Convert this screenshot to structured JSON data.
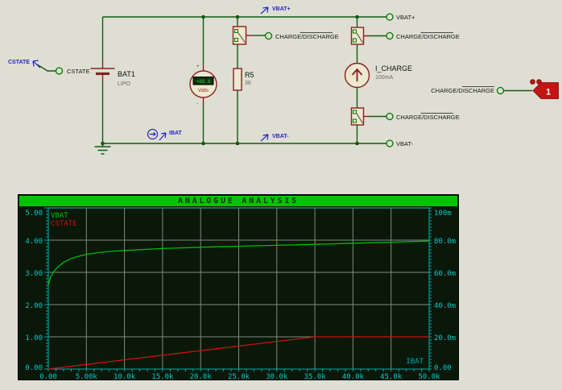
{
  "schematic": {
    "labels": {
      "cstate_wire": "CSTATE",
      "cstate_terminal": "CSTATE",
      "vbat_plus_wire": "VBAT+",
      "vbat_minus_wire": "VBAT-",
      "ibat_wire": "IBAT",
      "vbat_plus_terminal": "VBAT+",
      "vbat_minus_terminal": "VBAT-",
      "charge_discharge": "CHARGE/DISCHARGE"
    },
    "battery": {
      "ref": "BAT1",
      "value": "LIPO"
    },
    "resistor": {
      "ref": "R5",
      "value": "36"
    },
    "current_source": {
      "ref": "I_CHARGE",
      "value": "100mA"
    },
    "voltmeter": {
      "reading": "+88.8",
      "unit_label": "Volts",
      "plus": "+",
      "minus": "-"
    },
    "logic_probe": {
      "state": "1"
    },
    "colors": {
      "wire": "#145A14",
      "component": "#8C1E1E",
      "wire_label_blue": "#2828BE",
      "probe_red": "#C41414",
      "terminal_green": "#007A00"
    }
  },
  "chart_data": {
    "type": "line",
    "title": "ANALOGUE ANALYSIS",
    "grid": true,
    "legend_position": "top-left (left axis), bottom-right (right axis)",
    "x_axis": {
      "max": 50000,
      "ticks": [
        {
          "v": 0,
          "label": "0.00"
        },
        {
          "v": 5000,
          "label": "5.00k"
        },
        {
          "v": 10000,
          "label": "10.0k"
        },
        {
          "v": 15000,
          "label": "15.0k"
        },
        {
          "v": 20000,
          "label": "20.0k"
        },
        {
          "v": 25000,
          "label": "25.0k"
        },
        {
          "v": 30000,
          "label": "30.0k"
        },
        {
          "v": 35000,
          "label": "35.0k"
        },
        {
          "v": 40000,
          "label": "40.0k"
        },
        {
          "v": 45000,
          "label": "45.0k"
        },
        {
          "v": 50000,
          "label": "50.0k"
        }
      ]
    },
    "left_axis": {
      "range": [
        0,
        5
      ],
      "ticks": [
        {
          "v": 0,
          "label": "0.00"
        },
        {
          "v": 1,
          "label": "1.00"
        },
        {
          "v": 2,
          "label": "2.00"
        },
        {
          "v": 3,
          "label": "3.00"
        },
        {
          "v": 4,
          "label": "4.00"
        },
        {
          "v": 5,
          "label": "5.00"
        }
      ]
    },
    "right_axis": {
      "range": [
        0,
        0.1
      ],
      "ticks": [
        {
          "v": 0,
          "label": "0.00"
        },
        {
          "v": 0.02,
          "label": "20.0m"
        },
        {
          "v": 0.04,
          "label": "40.0m"
        },
        {
          "v": 0.06,
          "label": "60.0m"
        },
        {
          "v": 0.08,
          "label": "80.0m"
        },
        {
          "v": 0.1,
          "label": "100m"
        }
      ]
    },
    "series": [
      {
        "name": "VBAT",
        "axis": "left",
        "color": "#00BB00",
        "points": [
          [
            0,
            2.6
          ],
          [
            300,
            2.85
          ],
          [
            700,
            3.02
          ],
          [
            1200,
            3.16
          ],
          [
            2000,
            3.31
          ],
          [
            3000,
            3.43
          ],
          [
            4000,
            3.5
          ],
          [
            5000,
            3.56
          ],
          [
            6500,
            3.61
          ],
          [
            8000,
            3.65
          ],
          [
            10000,
            3.68
          ],
          [
            12500,
            3.71
          ],
          [
            15000,
            3.74
          ],
          [
            17500,
            3.76
          ],
          [
            20000,
            3.78
          ],
          [
            22500,
            3.795
          ],
          [
            25000,
            3.81
          ],
          [
            27500,
            3.825
          ],
          [
            30000,
            3.84
          ],
          [
            32500,
            3.855
          ],
          [
            35000,
            3.87
          ],
          [
            37500,
            3.885
          ],
          [
            40000,
            3.905
          ],
          [
            42500,
            3.92
          ],
          [
            45000,
            3.935
          ],
          [
            47500,
            3.955
          ],
          [
            50000,
            3.97
          ]
        ]
      },
      {
        "name": "CSTATE",
        "axis": "left",
        "color": "#CC1111",
        "points": [
          [
            0,
            0
          ],
          [
            35000,
            1.0
          ],
          [
            50000,
            1.0
          ]
        ]
      },
      {
        "name": "IBAT",
        "axis": "right",
        "color": "#00AAAA",
        "points": [
          [
            0,
            0.1
          ],
          [
            50000,
            0.1
          ]
        ]
      }
    ],
    "colors": {
      "titlebar": "#00C400",
      "title_text": "#003800",
      "plot_background": "#0A180A",
      "grid": "#7E8A7E",
      "axis": "#00A8A8",
      "tick_labels": "#00C8C8"
    }
  }
}
